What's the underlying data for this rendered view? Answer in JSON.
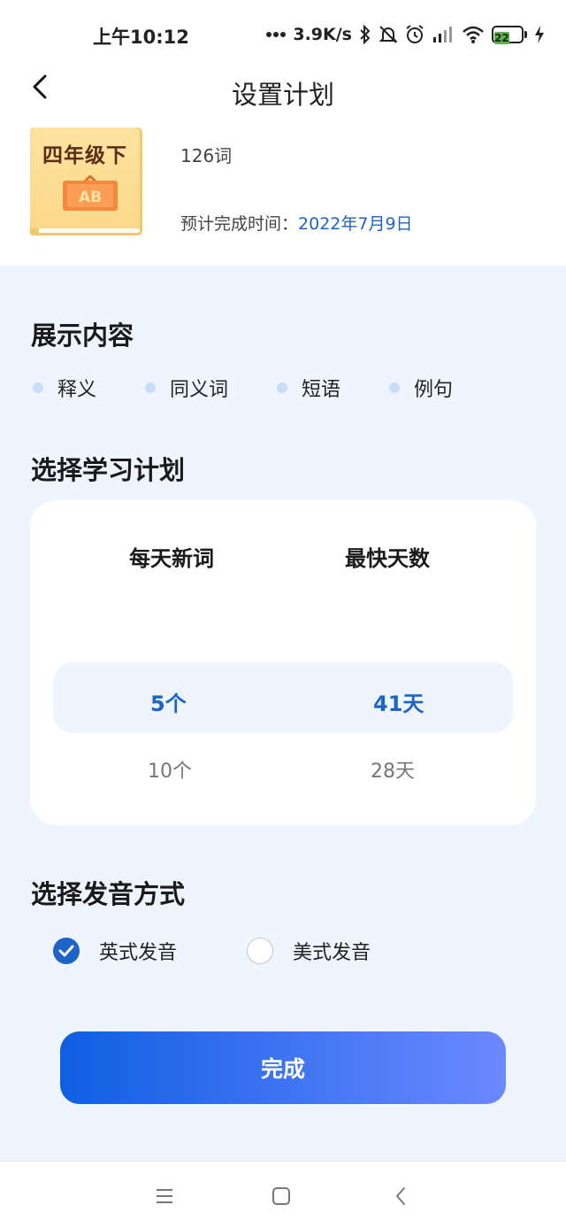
{
  "status_bar": {
    "time": "上午10:12",
    "speed": "3.9K/s",
    "battery": "22",
    "colors": {
      "battery": "#58b548"
    }
  },
  "header": {
    "title": "设置计划",
    "book": {
      "cover_title": "四年级下",
      "board_text": "AB",
      "word_count": "126词",
      "finish_label": "预计完成时间：",
      "finish_date": "2022年7月9日"
    }
  },
  "display_content": {
    "title": "展示内容",
    "options": [
      "释义",
      "同义词",
      "短语",
      "例句"
    ]
  },
  "plan": {
    "title": "选择学习计划",
    "columns": [
      "每天新词",
      "最快天数"
    ],
    "selected": {
      "words": "5个",
      "days": "41天"
    },
    "next": {
      "words": "10个",
      "days": "28天"
    }
  },
  "pronunciation": {
    "title": "选择发音方式",
    "options": [
      {
        "label": "英式发音",
        "checked": true
      },
      {
        "label": "美式发音",
        "checked": false
      }
    ]
  },
  "done_button": {
    "label": "完成"
  },
  "colors": {
    "accent": "#1e63c6",
    "background": "#eef5fe",
    "button_start": "#0f5fe3",
    "button_end": "#6c88ff"
  }
}
